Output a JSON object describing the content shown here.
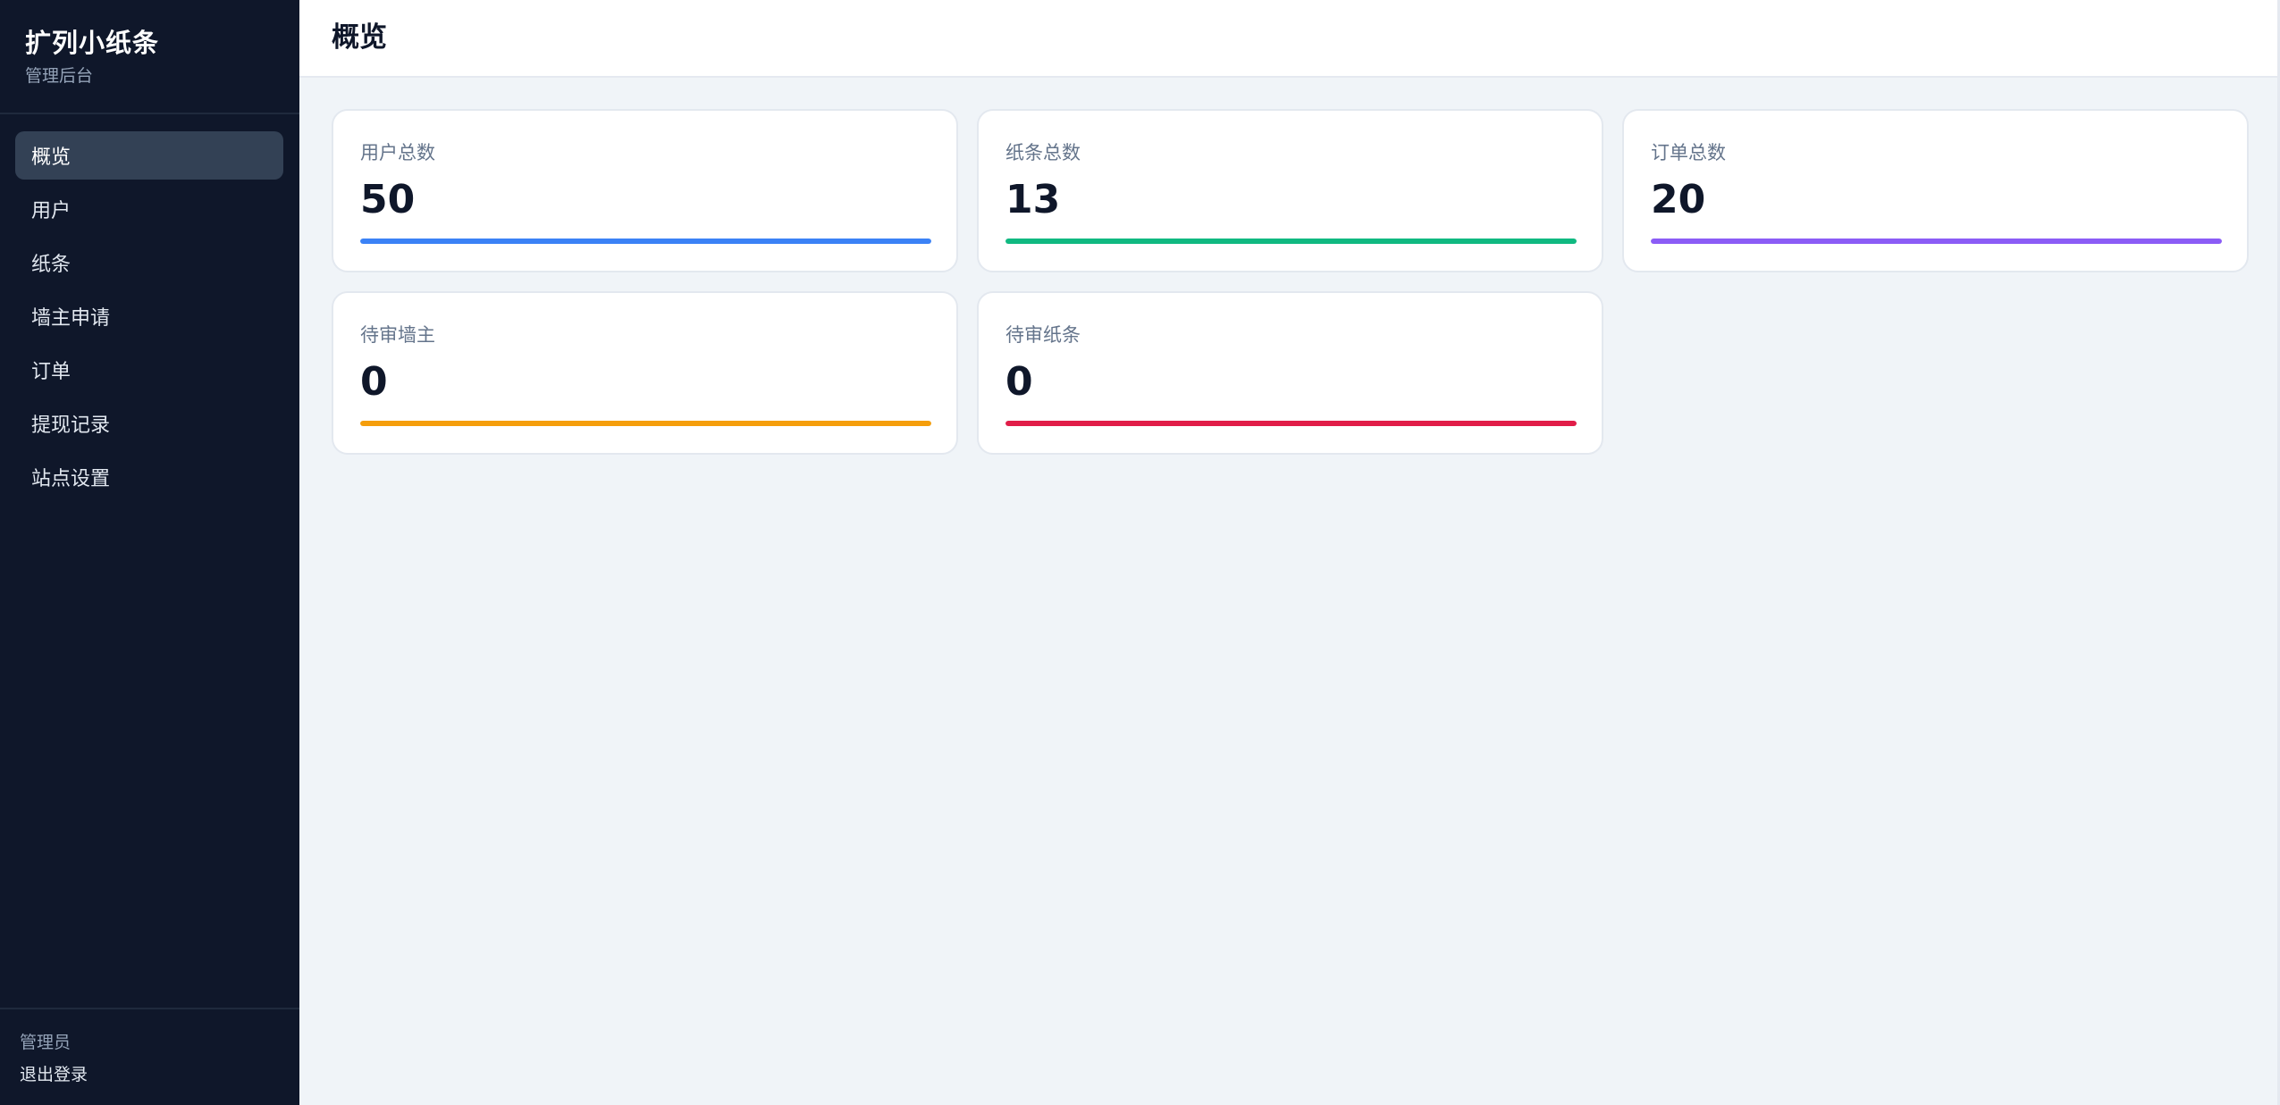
{
  "sidebar": {
    "brand_title": "扩列小纸条",
    "brand_subtitle": "管理后台",
    "items": [
      {
        "label": "概览",
        "active": true
      },
      {
        "label": "用户",
        "active": false
      },
      {
        "label": "纸条",
        "active": false
      },
      {
        "label": "墙主申请",
        "active": false
      },
      {
        "label": "订单",
        "active": false
      },
      {
        "label": "提现记录",
        "active": false
      },
      {
        "label": "站点设置",
        "active": false
      }
    ],
    "footer_role": "管理员",
    "footer_logout": "退出登录"
  },
  "header": {
    "title": "概览"
  },
  "stats": [
    {
      "label": "用户总数",
      "value": "50",
      "color": "#3b82f6",
      "fill": 1.0
    },
    {
      "label": "纸条总数",
      "value": "13",
      "color": "#10b981",
      "fill": 1.0
    },
    {
      "label": "订单总数",
      "value": "20",
      "color": "#8b5cf6",
      "fill": 1.0
    },
    {
      "label": "待审墙主",
      "value": "0",
      "color": "#f59e0b",
      "fill": 1.0
    },
    {
      "label": "待审纸条",
      "value": "0",
      "color": "#e11d48",
      "fill": 1.0
    }
  ],
  "colors": {
    "sidebar_bg": "#0f172a",
    "active_item_bg": "#334155",
    "main_bg": "#f0f4f8"
  }
}
